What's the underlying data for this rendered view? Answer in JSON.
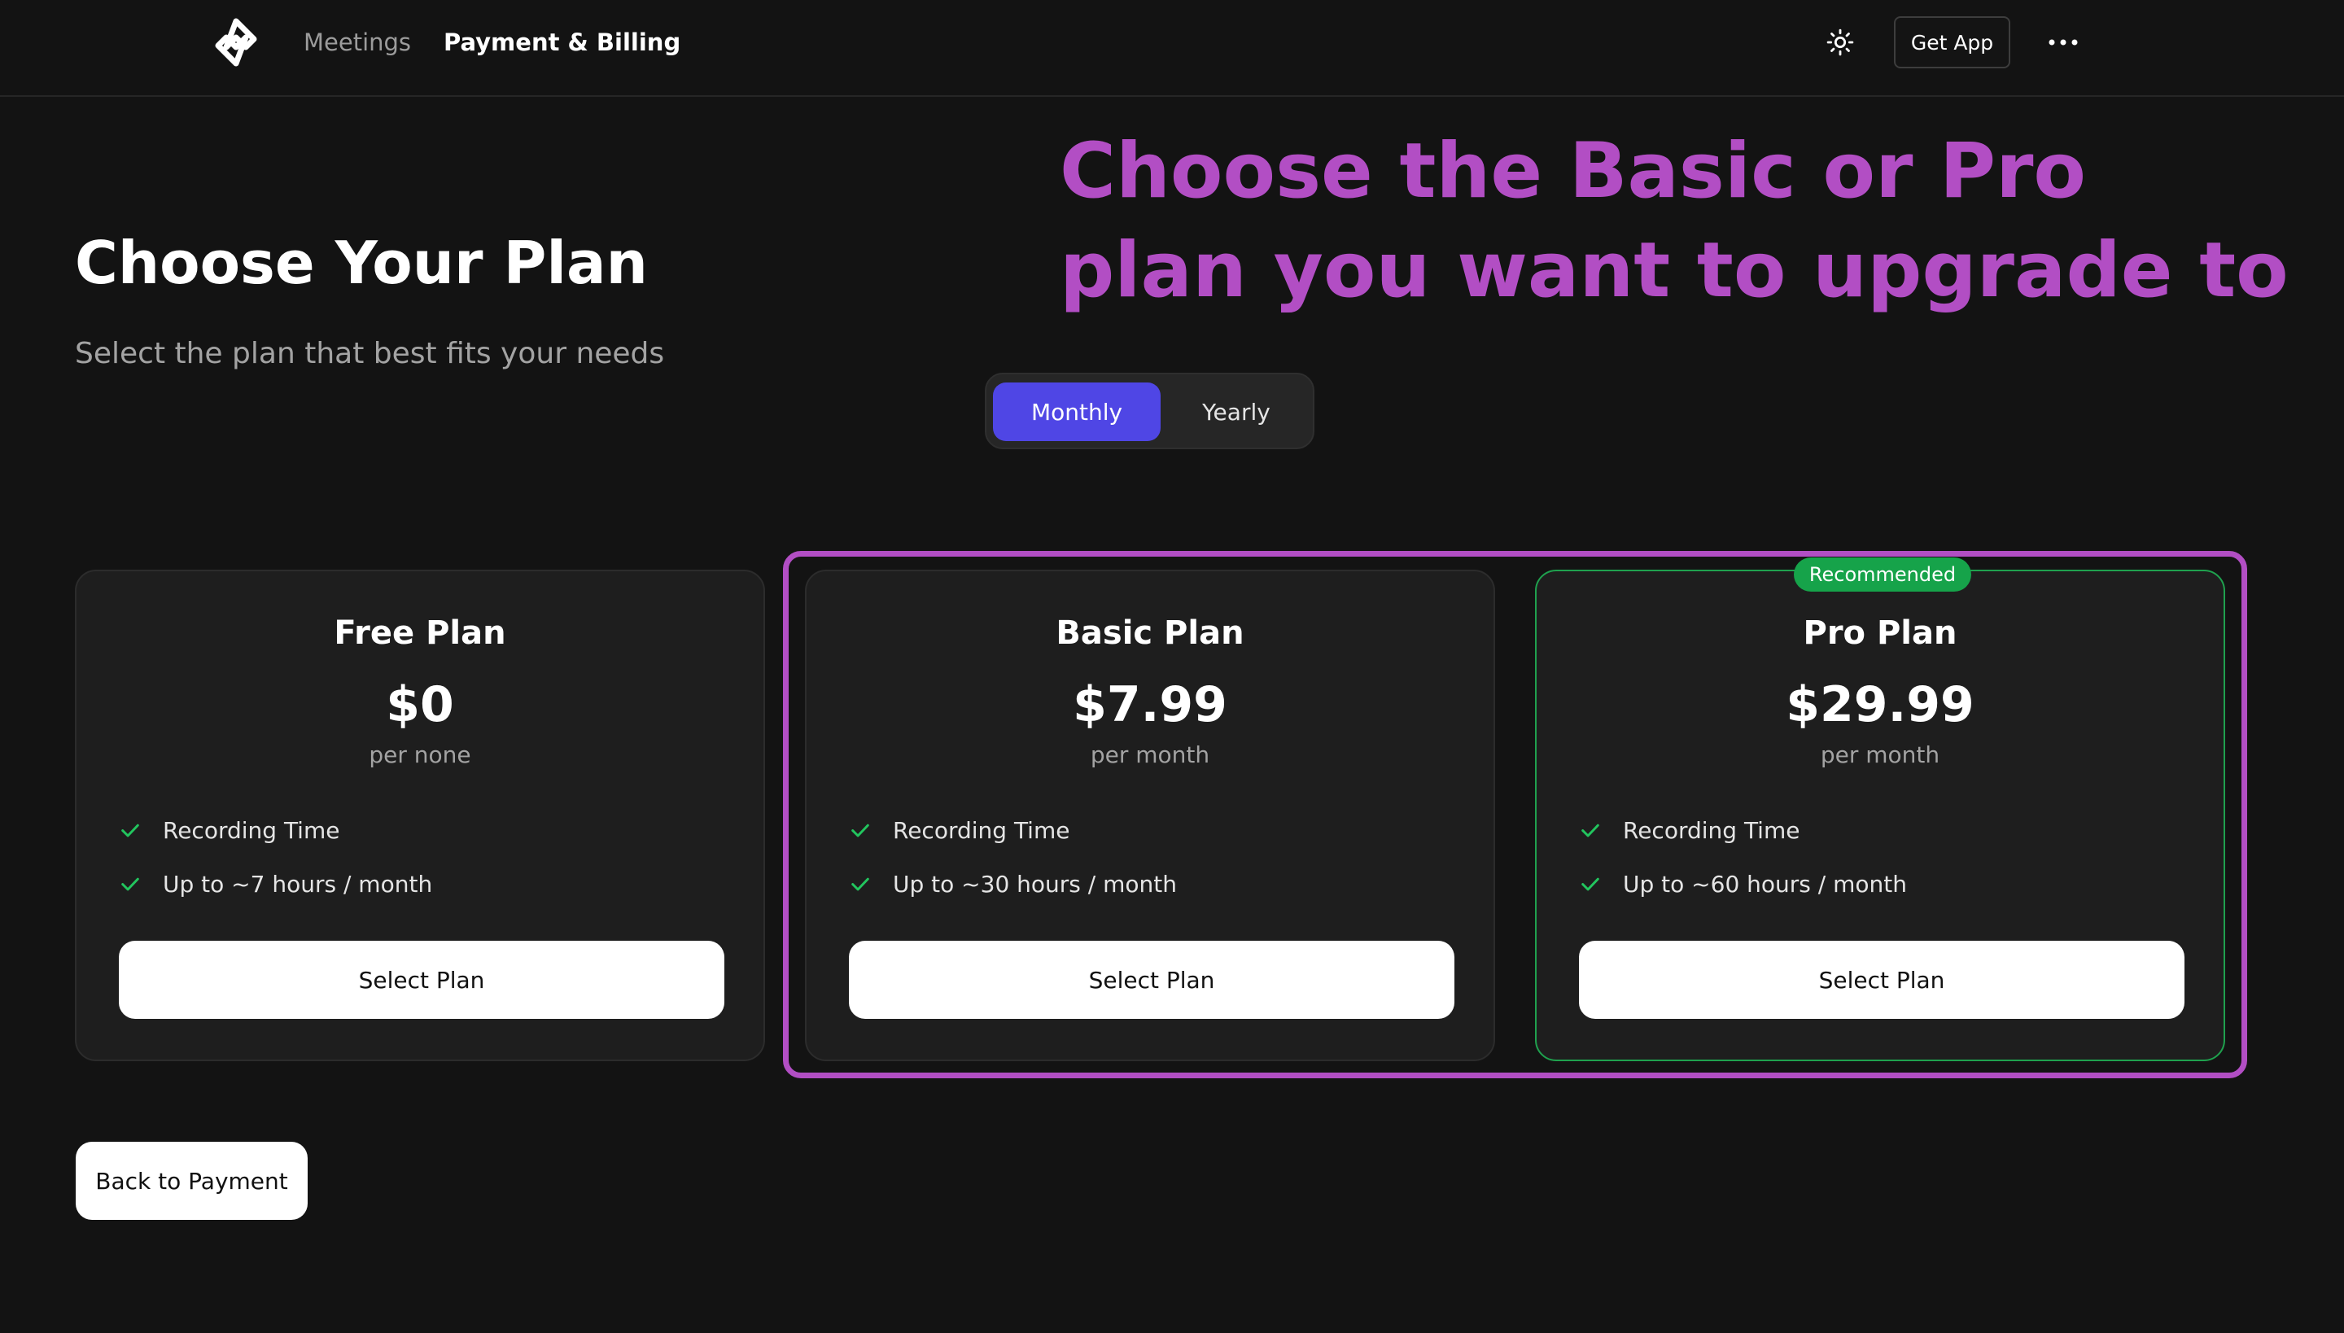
{
  "nav": {
    "logo_icon": "logo-icon",
    "links": [
      {
        "label": "Meetings",
        "active": false
      },
      {
        "label": "Payment & Billing",
        "active": true
      }
    ],
    "theme_icon": "sun-icon",
    "get_app_label": "Get App",
    "more_icon": "more-horizontal-icon"
  },
  "header": {
    "title": "Choose Your Plan",
    "subtitle": "Select the plan that best fits your needs"
  },
  "annotation": {
    "text": "Choose the Basic or Pro plan you want to upgrade to",
    "color": "#b24ec4"
  },
  "billing_toggle": {
    "options": [
      "Monthly",
      "Yearly"
    ],
    "selected": "Monthly",
    "accent": "#4f46e5"
  },
  "plans": [
    {
      "name": "Free Plan",
      "price": "$0",
      "period": "per none",
      "features": [
        "Recording Time",
        "Up to ~7 hours / month"
      ],
      "button_label": "Select Plan"
    },
    {
      "name": "Basic Plan",
      "price": "$7.99",
      "period": "per month",
      "features": [
        "Recording Time",
        "Up to ~30 hours / month"
      ],
      "button_label": "Select Plan"
    },
    {
      "name": "Pro Plan",
      "price": "$29.99",
      "period": "per month",
      "badge": "Recommended",
      "features": [
        "Recording Time",
        "Up to ~60 hours / month"
      ],
      "button_label": "Select Plan"
    }
  ],
  "colors": {
    "background": "#131313",
    "card": "#1e1e1e",
    "check": "#22c55e",
    "recommended": "#16a34a"
  },
  "back_button_label": "Back to Payment"
}
